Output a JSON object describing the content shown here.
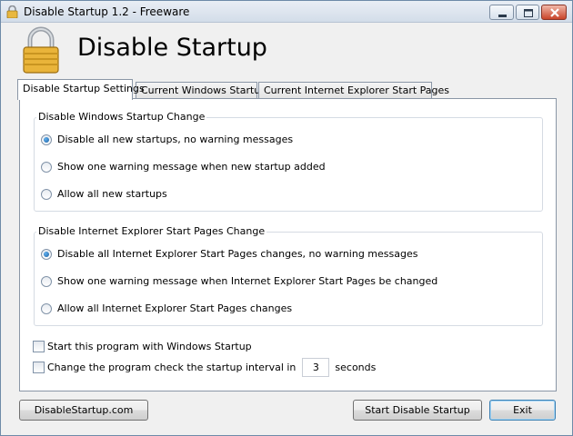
{
  "window": {
    "title": "Disable Startup 1.2 - Freeware"
  },
  "header": {
    "title": "Disable Startup"
  },
  "tabs": [
    {
      "label": "Disable Startup Settings",
      "active": true
    },
    {
      "label": "Current Windows Startup",
      "active": false
    },
    {
      "label": "Current Internet Explorer Start Pages",
      "active": false
    }
  ],
  "groups": {
    "windows": {
      "label": "Disable Windows Startup Change",
      "options": [
        {
          "label": "Disable all new startups, no warning messages",
          "checked": true
        },
        {
          "label": "Show one warning message when new startup added",
          "checked": false
        },
        {
          "label": "Allow all new startups",
          "checked": false
        }
      ]
    },
    "ie": {
      "label": "Disable Internet Explorer Start Pages Change",
      "options": [
        {
          "label": "Disable all Internet Explorer Start Pages changes, no warning messages",
          "checked": true
        },
        {
          "label": "Show one warning message when Internet Explorer Start Pages be changed",
          "checked": false
        },
        {
          "label": "Allow all Internet Explorer Start Pages changes",
          "checked": false
        }
      ]
    }
  },
  "checkboxes": {
    "start_with_windows": {
      "label": "Start this program with Windows Startup",
      "checked": false
    },
    "check_interval": {
      "label": "Change the program check the startup interval in",
      "checked": false,
      "value": "3",
      "unit": "seconds"
    }
  },
  "buttons": {
    "website": "DisableStartup.com",
    "start": "Start Disable Startup",
    "exit": "Exit"
  },
  "colors": {
    "window_border": "#6e8aa8",
    "panel_border": "#8a96a6",
    "radio_fill": "#1c5f9f"
  }
}
